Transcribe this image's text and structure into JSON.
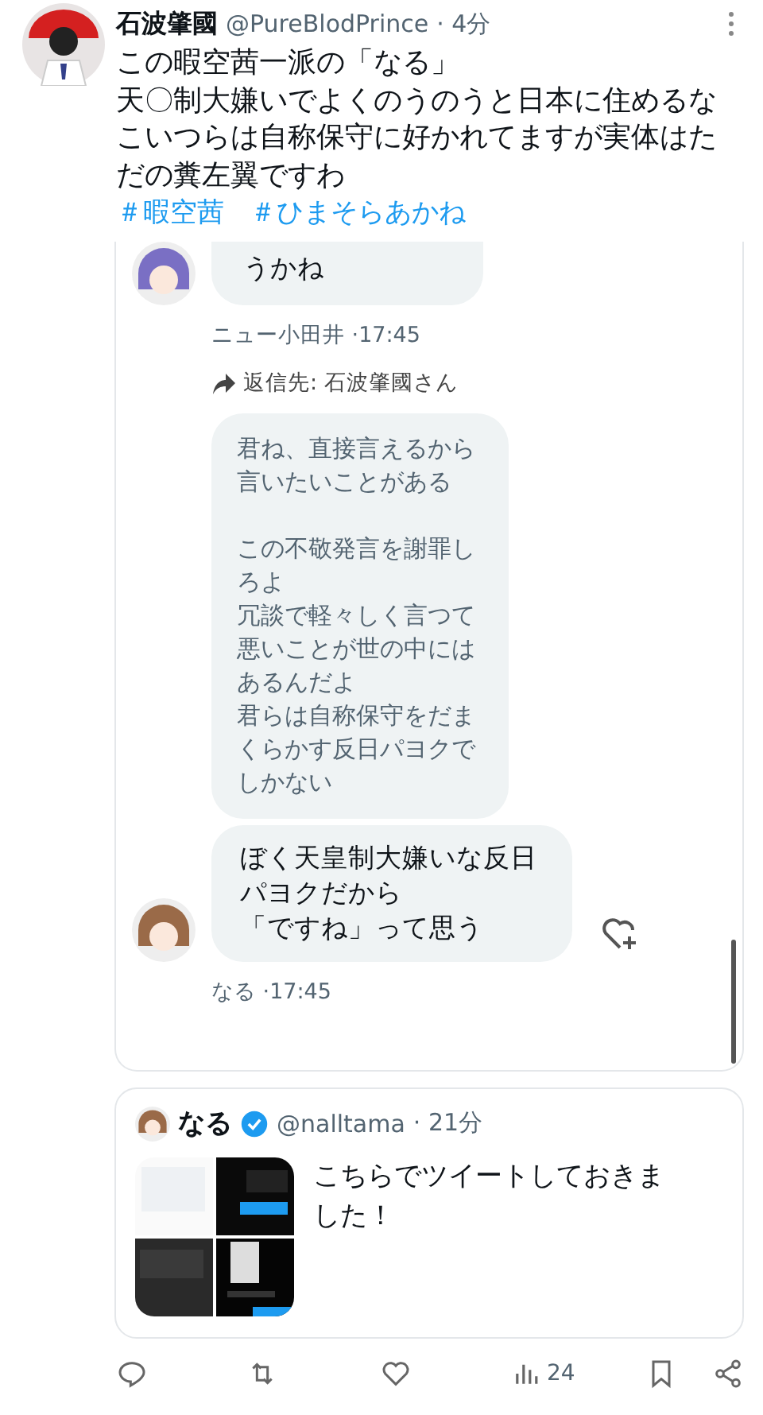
{
  "post": {
    "name": "石波肇國",
    "handle": "@PureBlodPrince",
    "time": "· 4分",
    "lines": [
      "この暇空茜一派の「なる」",
      "天〇制大嫌いでよくのうのうと日本に住めるなこいつらは自称保守に好かれてますが実体はただの糞左翼ですわ"
    ],
    "hashtags": [
      "＃暇空茜",
      "＃ひまそらあかね"
    ]
  },
  "chat": {
    "messages": [
      {
        "kind": "bubble",
        "paragraphs": [
          [
            "うかね"
          ]
        ],
        "avatar": true
      },
      {
        "kind": "meta",
        "text": "ニュー小田井 ·17:45"
      },
      {
        "kind": "reply",
        "text": "返信先: 石波肇國さん"
      },
      {
        "kind": "muted_bubble",
        "paragraphs": [
          [
            "君ね、直接言えるから言いたいことがある"
          ],
          [
            "この不敬発言を謝罪しろよ",
            "冗談で軽々しく言つて悪いことが世の中にはあるんだよ",
            "君らは自称保守をだまくらかす反日パヨクでしかない"
          ]
        ],
        "avatar": false
      },
      {
        "kind": "bubble",
        "paragraphs": [
          [
            "ぼく天皇制大嫌いな反日パヨクだから",
            "「ですね」って思う"
          ]
        ],
        "avatar": true,
        "react": true
      },
      {
        "kind": "meta",
        "text": "なる ·17:45"
      }
    ]
  },
  "quote": {
    "name": "なる",
    "verified": true,
    "handle": "@nalltama",
    "time": "· 21分",
    "text": "こちらでツイートしておきました！"
  },
  "actions": {
    "views": "24"
  }
}
